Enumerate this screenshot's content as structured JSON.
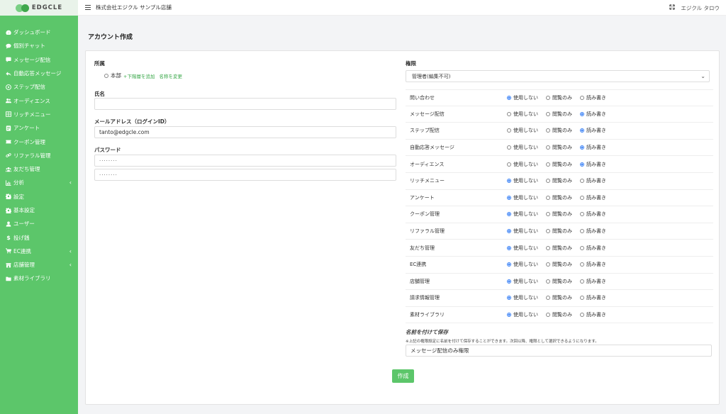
{
  "logo": {
    "text": "EDGCLE"
  },
  "header": {
    "store_name": "株式会社エジクル サンプル店舗",
    "user_last": "エジクル",
    "user_first": "タロウ"
  },
  "sidebar": {
    "items": [
      {
        "label": "ダッシュボード",
        "icon": "dashboard-icon"
      },
      {
        "label": "個別チャット",
        "icon": "chat-icon"
      },
      {
        "label": "メッセージ配信",
        "icon": "message-icon"
      },
      {
        "label": "自動応答メッセージ",
        "icon": "reply-icon"
      },
      {
        "label": "ステップ配信",
        "icon": "step-icon"
      },
      {
        "label": "オーディエンス",
        "icon": "audience-icon"
      },
      {
        "label": "リッチメニュー",
        "icon": "rich-menu-icon"
      },
      {
        "label": "アンケート",
        "icon": "survey-icon"
      },
      {
        "label": "クーポン管理",
        "icon": "coupon-icon"
      },
      {
        "label": "リファラル管理",
        "icon": "link-icon"
      },
      {
        "label": "友だち管理",
        "icon": "friends-icon"
      },
      {
        "label": "分析",
        "icon": "chart-icon",
        "chevron": "‹"
      },
      {
        "label": "設定",
        "icon": "gear-icon"
      },
      {
        "label": "基本設定",
        "icon": "gear-icon"
      },
      {
        "label": "ユーザー",
        "icon": "user-icon"
      },
      {
        "label": "投げ銭",
        "icon": "dollar-icon"
      },
      {
        "label": "EC連携",
        "icon": "cart-icon",
        "chevron": "‹"
      },
      {
        "label": "店舗管理",
        "icon": "store-icon",
        "chevron": "‹"
      },
      {
        "label": "素材ライブラリ",
        "icon": "folder-icon"
      }
    ]
  },
  "page": {
    "title": "アカウント作成"
  },
  "form": {
    "affiliation_label": "所属",
    "affiliation_value": "本部",
    "add_sub_link": "+下階層を追加",
    "rename_link": "名称を変更",
    "name_label": "氏名",
    "name_value": "",
    "email_label": "メールアドレス（ログインID）",
    "email_value": "tanto@edgcle.com",
    "password_label": "パスワード",
    "password_value": "········",
    "password_confirm_value": "········"
  },
  "permissions": {
    "label": "権限",
    "role_selected": "管理者(編集不可)",
    "options": [
      "使用しない",
      "閲覧のみ",
      "読み書き"
    ],
    "rows": [
      {
        "name": "問い合わせ",
        "selected": 0
      },
      {
        "name": "メッセージ配信",
        "selected": 2
      },
      {
        "name": "ステップ配信",
        "selected": 2
      },
      {
        "name": "自動応答メッセージ",
        "selected": 2
      },
      {
        "name": "オーディエンス",
        "selected": 2
      },
      {
        "name": "リッチメニュー",
        "selected": 0
      },
      {
        "name": "アンケート",
        "selected": 0
      },
      {
        "name": "クーポン管理",
        "selected": 0
      },
      {
        "name": "リファラル管理",
        "selected": 0
      },
      {
        "name": "友だち管理",
        "selected": 0
      },
      {
        "name": "EC連携",
        "selected": 0
      },
      {
        "name": "店舗管理",
        "selected": 0
      },
      {
        "name": "請求情報管理",
        "selected": 0
      },
      {
        "name": "素材ライブラリ",
        "selected": 0
      }
    ],
    "save_title": "名前を付けて保存",
    "save_note": "※上記の権限設定に名前を付けて保存することができます。次回以降、権限として選択できるようになります。",
    "save_name_value": "メッセージ配信のみ権限"
  },
  "submit_label": "作成",
  "colors": {
    "brand": "#5cc66a",
    "radio_on": "#3b82f6"
  }
}
